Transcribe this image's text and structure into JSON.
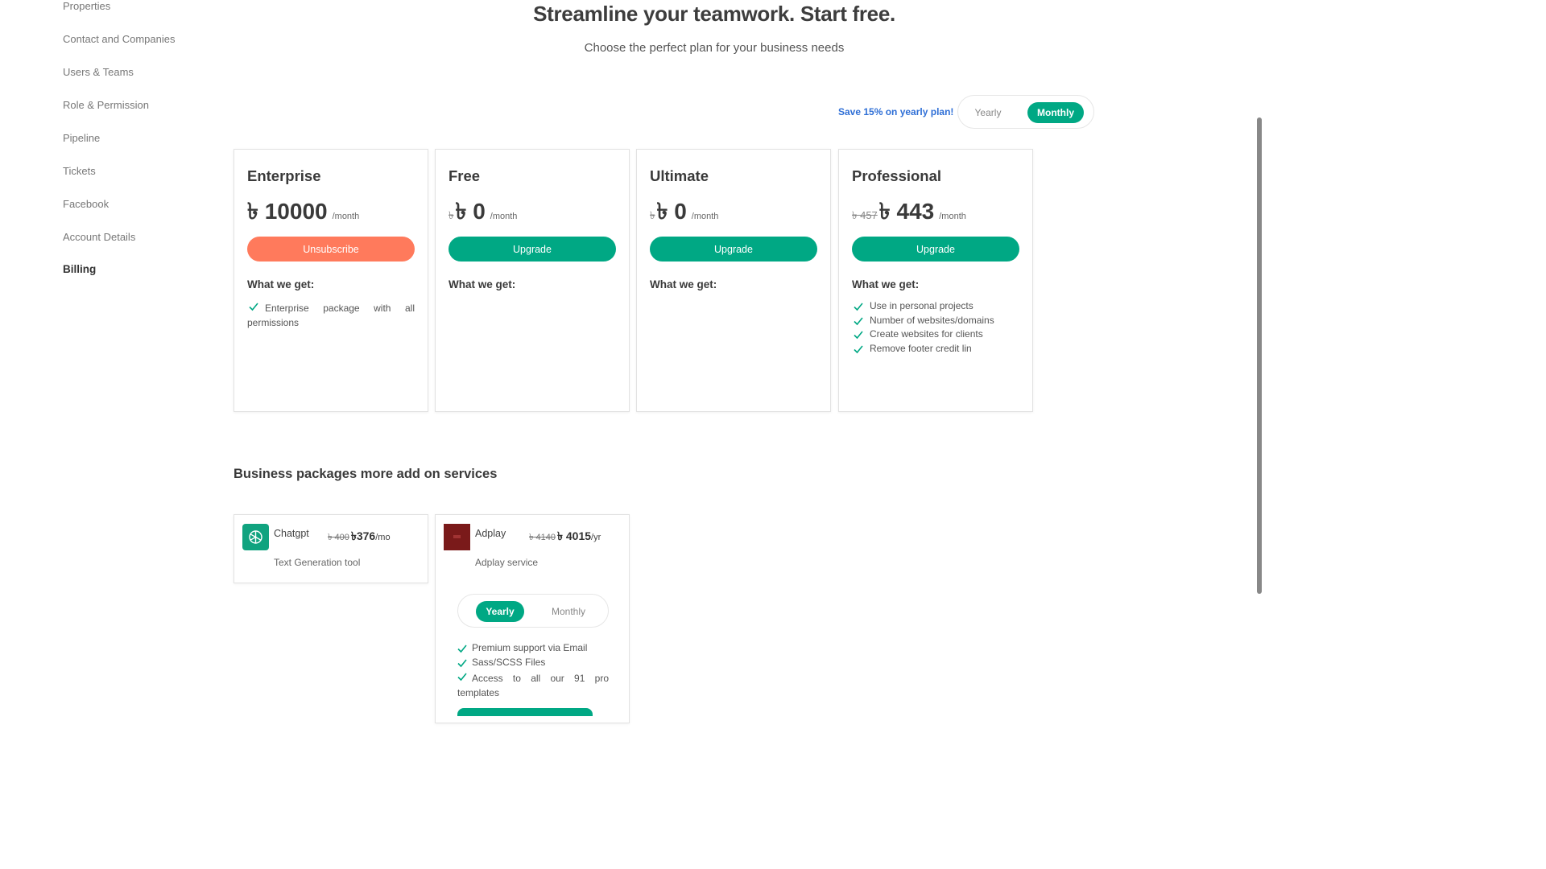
{
  "sidebar": {
    "items": [
      {
        "label": "Properties"
      },
      {
        "label": "Contact and Companies"
      },
      {
        "label": "Users & Teams"
      },
      {
        "label": "Role & Permission"
      },
      {
        "label": "Pipeline"
      },
      {
        "label": "Tickets"
      },
      {
        "label": "Facebook"
      },
      {
        "label": "Account Details"
      },
      {
        "label": "Billing"
      }
    ],
    "active": "Billing"
  },
  "header": {
    "title": "Streamline your teamwork. Start free.",
    "subtitle": "Choose the perfect plan for your business needs"
  },
  "billing_toggle": {
    "save_note": "Save 15% on yearly plan!",
    "yearly": "Yearly",
    "monthly": "Monthly",
    "selected": "Monthly"
  },
  "plans": [
    {
      "name": "Enterprise",
      "old_price": "",
      "price": "৳ 10000",
      "unit": "/month",
      "button": "Unsubscribe",
      "what_we_get": "What we get:",
      "features": [
        "Enterprise package with all permissions"
      ]
    },
    {
      "name": "Free",
      "old_price": "৳",
      "price": "৳ 0",
      "unit": "/month",
      "button": "Upgrade",
      "what_we_get": "What we get:",
      "features": []
    },
    {
      "name": "Ultimate",
      "old_price": "৳",
      "price": "৳ 0",
      "unit": "/month",
      "button": "Upgrade",
      "what_we_get": "What we get:",
      "features": []
    },
    {
      "name": "Professional",
      "old_price": "৳ 457",
      "price": "৳ 443",
      "unit": "/month",
      "button": "Upgrade",
      "what_we_get": "What we get:",
      "features": [
        "Use in personal projects",
        "Number of websites/domains",
        "Create websites for clients",
        "Remove footer credit lin"
      ]
    }
  ],
  "addons_section": {
    "title": "Business packages more add on services",
    "items": [
      {
        "name": "Chatgpt",
        "old_price": "৳ 400",
        "price": "৳376",
        "unit": "/mo",
        "description": "Text Generation tool",
        "logo_color": "#10a37f",
        "icon": "chatgpt-logo-icon"
      },
      {
        "name": "Adplay",
        "old_price": "৳ 4140",
        "price": "৳ 4015",
        "unit": "/yr",
        "description": "Adplay service",
        "logo_color": "#7a1a1a",
        "icon": "adplay-logo-icon",
        "toggle": {
          "yearly": "Yearly",
          "monthly": "Monthly",
          "selected": "Yearly"
        },
        "features": [
          "Premium support via Email",
          "Sass/SCSS Files",
          "Access to all our 91 pro templates"
        ]
      }
    ]
  },
  "colors": {
    "accent": "#00a884",
    "danger": "#ff7a5c",
    "save_note": "#2f6fd6"
  }
}
